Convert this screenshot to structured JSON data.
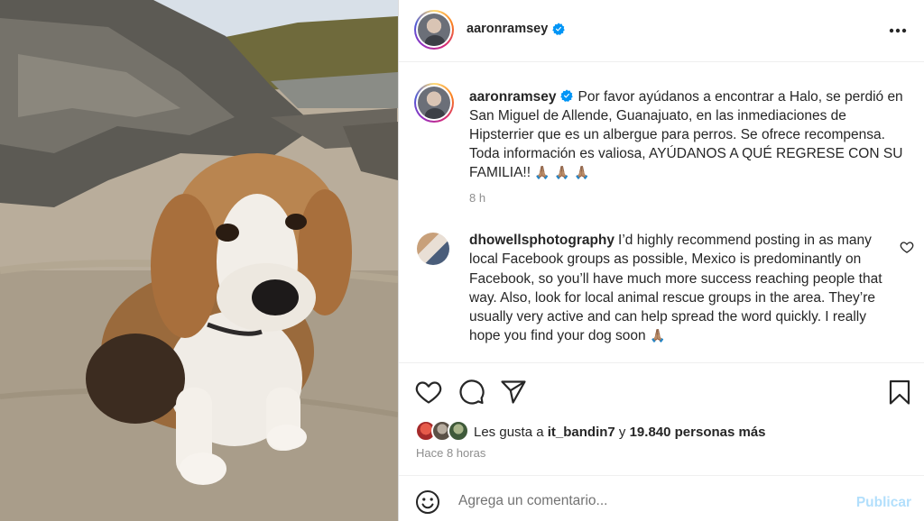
{
  "photo": {
    "alt_icon": "beagle-photo"
  },
  "header": {
    "username": "aaronramsey",
    "verified_icon": "verified-badge-icon",
    "more_icon": "more-options-icon"
  },
  "caption": {
    "username": "aaronramsey",
    "text": "Por favor ayúdanos a encontrar a Halo, se perdió en San Miguel de Allende, Guanajuato, en las inmediaciones de Hipsterrier que es un albergue para perros. Se ofrece recompensa. Toda información es valiosa, AYÚDANOS A QUÉ REGRESE CON SU FAMILIA!!",
    "emojis": "🙏🏽 🙏🏽 🙏🏽",
    "time": "8 h"
  },
  "comment": {
    "username": "dhowellsphotography",
    "text": "I’d highly recommend posting in as many local Facebook groups as possible, Mexico is predominantly on Facebook, so you’ll have much more success reaching people that way. Also, look for local animal rescue groups in the area. They’re usually very active and can help spread the word quickly. I really hope you find your dog soon",
    "emoji": "🙏🏽"
  },
  "actions": {
    "like_icon": "heart-icon",
    "comment_icon": "comment-icon",
    "share_icon": "share-icon",
    "save_icon": "bookmark-icon"
  },
  "likes": {
    "prefix": "Les gusta a ",
    "user": "it_bandin7",
    "middle": " y ",
    "count": "19.840 personas más"
  },
  "post_time": "Hace 8 horas",
  "add_comment": {
    "placeholder": "Agrega un comentario...",
    "publish_label": "Publicar",
    "emoji_icon": "smiley-icon"
  },
  "colors": {
    "verified": "#0095f6",
    "publish_disabled": "#b2dffc",
    "muted_text": "#8e8e8e"
  }
}
